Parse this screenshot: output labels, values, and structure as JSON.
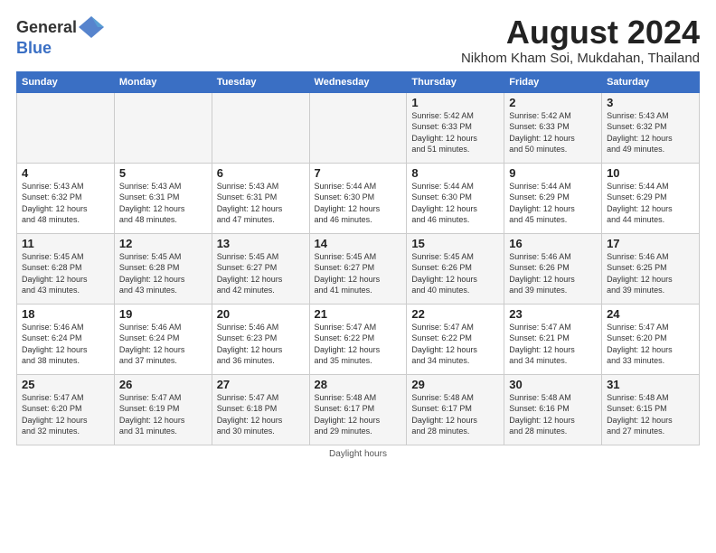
{
  "title": "August 2024",
  "location": "Nikhom Kham Soi, Mukdahan, Thailand",
  "logo": {
    "general": "General",
    "blue": "Blue"
  },
  "footer": {
    "note": "Daylight hours"
  },
  "days_of_week": [
    "Sunday",
    "Monday",
    "Tuesday",
    "Wednesday",
    "Thursday",
    "Friday",
    "Saturday"
  ],
  "weeks": [
    [
      {
        "day": "",
        "info": ""
      },
      {
        "day": "",
        "info": ""
      },
      {
        "day": "",
        "info": ""
      },
      {
        "day": "",
        "info": ""
      },
      {
        "day": "1",
        "info": "Sunrise: 5:42 AM\nSunset: 6:33 PM\nDaylight: 12 hours\nand 51 minutes."
      },
      {
        "day": "2",
        "info": "Sunrise: 5:42 AM\nSunset: 6:33 PM\nDaylight: 12 hours\nand 50 minutes."
      },
      {
        "day": "3",
        "info": "Sunrise: 5:43 AM\nSunset: 6:32 PM\nDaylight: 12 hours\nand 49 minutes."
      }
    ],
    [
      {
        "day": "4",
        "info": "Sunrise: 5:43 AM\nSunset: 6:32 PM\nDaylight: 12 hours\nand 48 minutes."
      },
      {
        "day": "5",
        "info": "Sunrise: 5:43 AM\nSunset: 6:31 PM\nDaylight: 12 hours\nand 48 minutes."
      },
      {
        "day": "6",
        "info": "Sunrise: 5:43 AM\nSunset: 6:31 PM\nDaylight: 12 hours\nand 47 minutes."
      },
      {
        "day": "7",
        "info": "Sunrise: 5:44 AM\nSunset: 6:30 PM\nDaylight: 12 hours\nand 46 minutes."
      },
      {
        "day": "8",
        "info": "Sunrise: 5:44 AM\nSunset: 6:30 PM\nDaylight: 12 hours\nand 46 minutes."
      },
      {
        "day": "9",
        "info": "Sunrise: 5:44 AM\nSunset: 6:29 PM\nDaylight: 12 hours\nand 45 minutes."
      },
      {
        "day": "10",
        "info": "Sunrise: 5:44 AM\nSunset: 6:29 PM\nDaylight: 12 hours\nand 44 minutes."
      }
    ],
    [
      {
        "day": "11",
        "info": "Sunrise: 5:45 AM\nSunset: 6:28 PM\nDaylight: 12 hours\nand 43 minutes."
      },
      {
        "day": "12",
        "info": "Sunrise: 5:45 AM\nSunset: 6:28 PM\nDaylight: 12 hours\nand 43 minutes."
      },
      {
        "day": "13",
        "info": "Sunrise: 5:45 AM\nSunset: 6:27 PM\nDaylight: 12 hours\nand 42 minutes."
      },
      {
        "day": "14",
        "info": "Sunrise: 5:45 AM\nSunset: 6:27 PM\nDaylight: 12 hours\nand 41 minutes."
      },
      {
        "day": "15",
        "info": "Sunrise: 5:45 AM\nSunset: 6:26 PM\nDaylight: 12 hours\nand 40 minutes."
      },
      {
        "day": "16",
        "info": "Sunrise: 5:46 AM\nSunset: 6:26 PM\nDaylight: 12 hours\nand 39 minutes."
      },
      {
        "day": "17",
        "info": "Sunrise: 5:46 AM\nSunset: 6:25 PM\nDaylight: 12 hours\nand 39 minutes."
      }
    ],
    [
      {
        "day": "18",
        "info": "Sunrise: 5:46 AM\nSunset: 6:24 PM\nDaylight: 12 hours\nand 38 minutes."
      },
      {
        "day": "19",
        "info": "Sunrise: 5:46 AM\nSunset: 6:24 PM\nDaylight: 12 hours\nand 37 minutes."
      },
      {
        "day": "20",
        "info": "Sunrise: 5:46 AM\nSunset: 6:23 PM\nDaylight: 12 hours\nand 36 minutes."
      },
      {
        "day": "21",
        "info": "Sunrise: 5:47 AM\nSunset: 6:22 PM\nDaylight: 12 hours\nand 35 minutes."
      },
      {
        "day": "22",
        "info": "Sunrise: 5:47 AM\nSunset: 6:22 PM\nDaylight: 12 hours\nand 34 minutes."
      },
      {
        "day": "23",
        "info": "Sunrise: 5:47 AM\nSunset: 6:21 PM\nDaylight: 12 hours\nand 34 minutes."
      },
      {
        "day": "24",
        "info": "Sunrise: 5:47 AM\nSunset: 6:20 PM\nDaylight: 12 hours\nand 33 minutes."
      }
    ],
    [
      {
        "day": "25",
        "info": "Sunrise: 5:47 AM\nSunset: 6:20 PM\nDaylight: 12 hours\nand 32 minutes."
      },
      {
        "day": "26",
        "info": "Sunrise: 5:47 AM\nSunset: 6:19 PM\nDaylight: 12 hours\nand 31 minutes."
      },
      {
        "day": "27",
        "info": "Sunrise: 5:47 AM\nSunset: 6:18 PM\nDaylight: 12 hours\nand 30 minutes."
      },
      {
        "day": "28",
        "info": "Sunrise: 5:48 AM\nSunset: 6:17 PM\nDaylight: 12 hours\nand 29 minutes."
      },
      {
        "day": "29",
        "info": "Sunrise: 5:48 AM\nSunset: 6:17 PM\nDaylight: 12 hours\nand 28 minutes."
      },
      {
        "day": "30",
        "info": "Sunrise: 5:48 AM\nSunset: 6:16 PM\nDaylight: 12 hours\nand 28 minutes."
      },
      {
        "day": "31",
        "info": "Sunrise: 5:48 AM\nSunset: 6:15 PM\nDaylight: 12 hours\nand 27 minutes."
      }
    ]
  ]
}
